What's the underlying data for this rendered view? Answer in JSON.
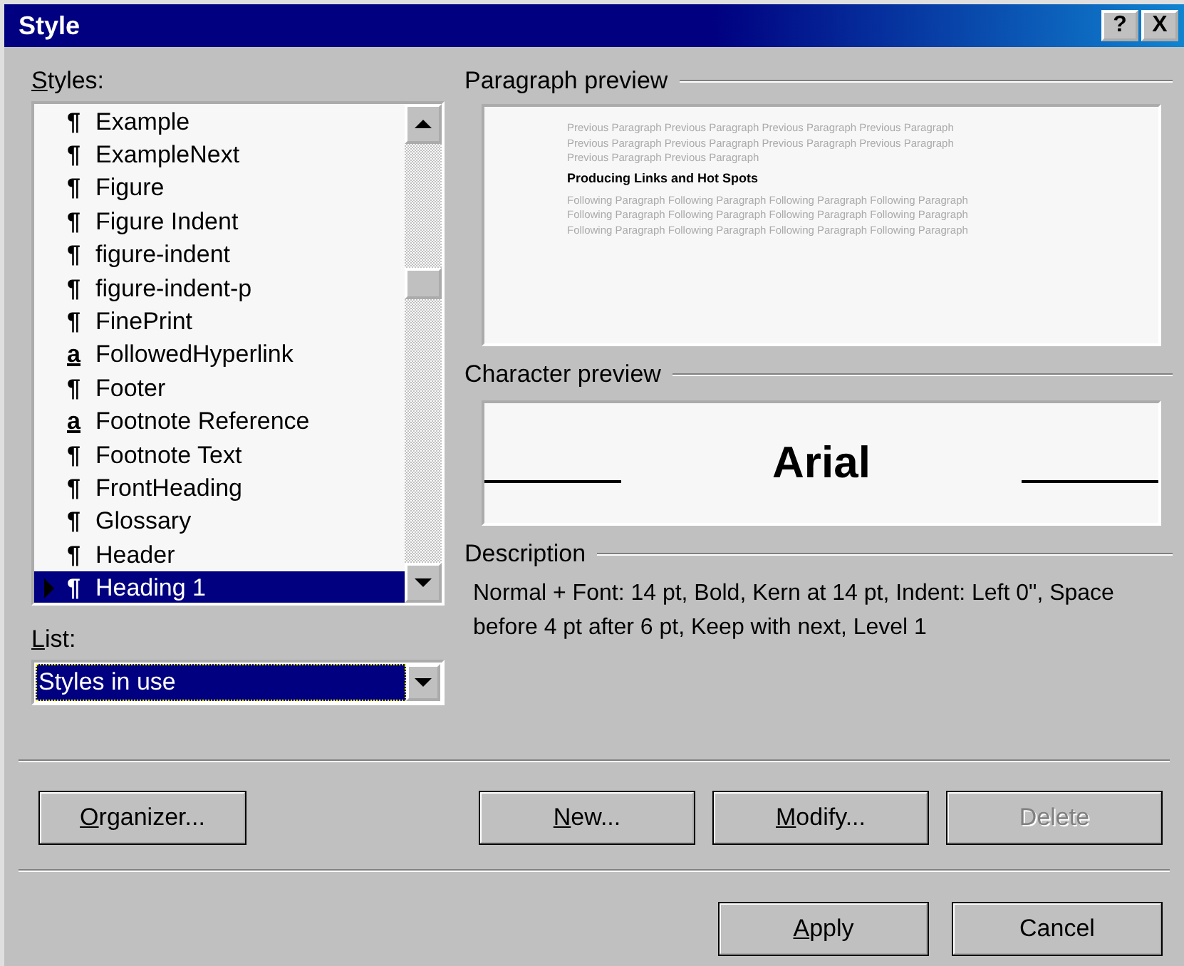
{
  "window": {
    "title": "Style",
    "help_button": "?",
    "close_button": "X"
  },
  "styles": {
    "label": "Styles:",
    "underline_first": true,
    "items": [
      {
        "symbol": "¶",
        "kind": "paragraph",
        "name": "Example",
        "selected": false
      },
      {
        "symbol": "¶",
        "kind": "paragraph",
        "name": "ExampleNext",
        "selected": false
      },
      {
        "symbol": "¶",
        "kind": "paragraph",
        "name": "Figure",
        "selected": false
      },
      {
        "symbol": "¶",
        "kind": "paragraph",
        "name": "Figure Indent",
        "selected": false
      },
      {
        "symbol": "¶",
        "kind": "paragraph",
        "name": "figure-indent",
        "selected": false
      },
      {
        "symbol": "¶",
        "kind": "paragraph",
        "name": "figure-indent-p",
        "selected": false
      },
      {
        "symbol": "¶",
        "kind": "paragraph",
        "name": "FinePrint",
        "selected": false
      },
      {
        "symbol": "a",
        "kind": "character",
        "name": "FollowedHyperlink",
        "selected": false
      },
      {
        "symbol": "¶",
        "kind": "paragraph",
        "name": "Footer",
        "selected": false
      },
      {
        "symbol": "a",
        "kind": "character",
        "name": "Footnote Reference",
        "selected": false
      },
      {
        "symbol": "¶",
        "kind": "paragraph",
        "name": "Footnote Text",
        "selected": false
      },
      {
        "symbol": "¶",
        "kind": "paragraph",
        "name": "FrontHeading",
        "selected": false
      },
      {
        "symbol": "¶",
        "kind": "paragraph",
        "name": "Glossary",
        "selected": false
      },
      {
        "symbol": "¶",
        "kind": "paragraph",
        "name": "Header",
        "selected": false
      },
      {
        "symbol": "¶",
        "kind": "paragraph",
        "name": "Heading 1",
        "selected": true
      }
    ]
  },
  "list": {
    "label": "List:",
    "underline_first": true,
    "value": "Styles in use"
  },
  "paragraph_preview": {
    "label": "Paragraph preview",
    "previous": [
      "Previous Paragraph Previous Paragraph Previous Paragraph Previous Paragraph",
      "Previous Paragraph Previous Paragraph Previous Paragraph Previous Paragraph",
      "Previous Paragraph Previous Paragraph"
    ],
    "current": "Producing Links and Hot Spots",
    "following": [
      "Following Paragraph Following Paragraph Following Paragraph Following Paragraph",
      "Following Paragraph Following Paragraph Following Paragraph Following Paragraph",
      "Following Paragraph Following Paragraph Following Paragraph Following Paragraph"
    ]
  },
  "character_preview": {
    "label": "Character preview",
    "sample": "Arial"
  },
  "description": {
    "label": "Description",
    "text": "Normal + Font: 14 pt, Bold, Kern at 14 pt, Indent:  Left 0\", Space before 4 pt  after 6 pt, Keep with next, Level 1"
  },
  "buttons": {
    "left": [
      {
        "label": "Organizer...",
        "underline_first": true,
        "disabled": false
      }
    ],
    "middle": [
      {
        "label": "New...",
        "underline_first": true,
        "disabled": false
      },
      {
        "label": "Modify...",
        "underline_first": true,
        "disabled": false
      },
      {
        "label": "Delete",
        "underline_first": false,
        "disabled": true
      }
    ],
    "bottom": [
      {
        "label": "Apply",
        "underline_first": true,
        "disabled": false
      },
      {
        "label": "Cancel",
        "underline_first": false,
        "disabled": false
      }
    ]
  }
}
